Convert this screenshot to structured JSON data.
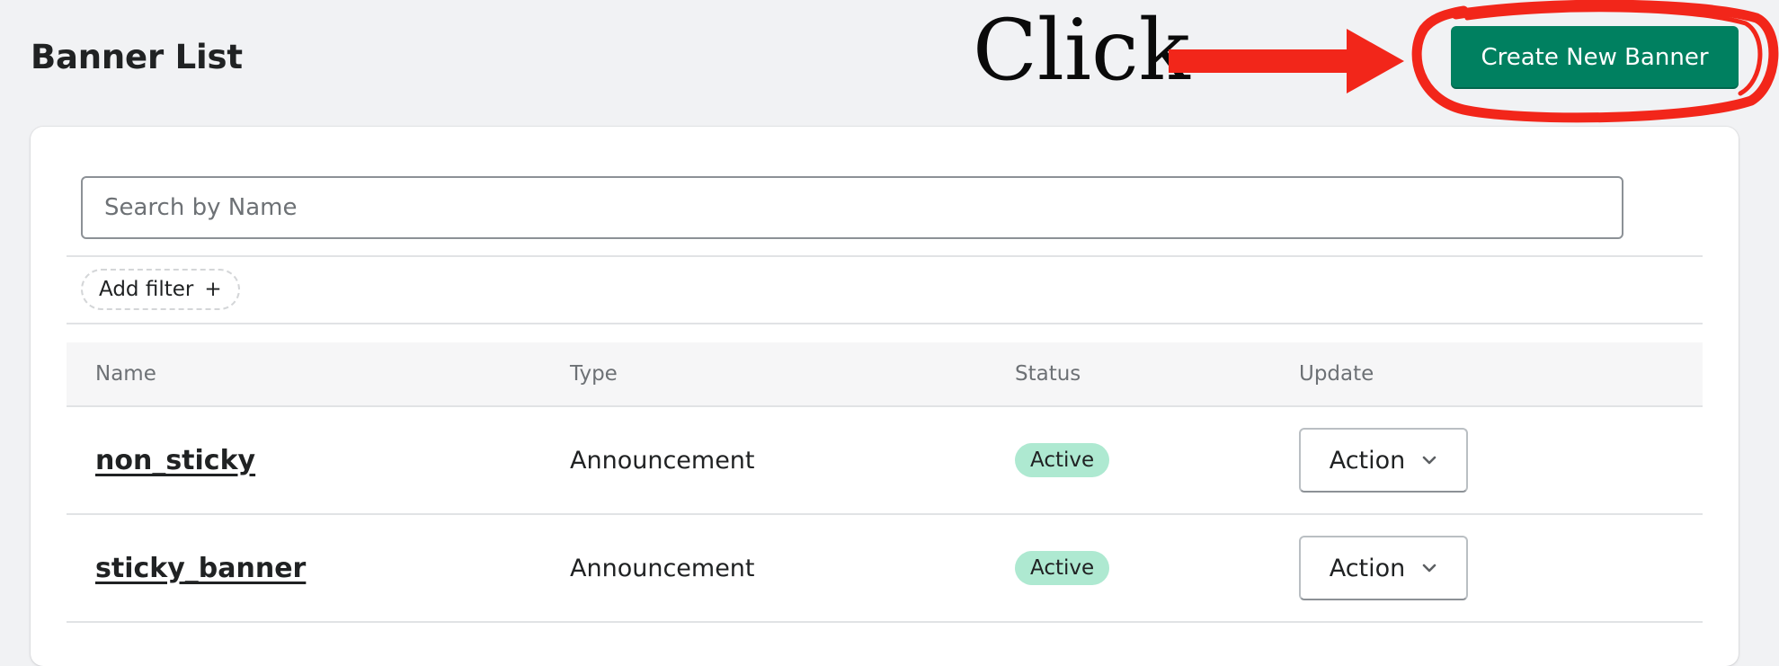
{
  "page": {
    "title": "Banner List"
  },
  "annotation": {
    "text": "Click",
    "color": "#f2261a"
  },
  "header": {
    "create_button_label": "Create New Banner"
  },
  "search": {
    "placeholder": "Search by Name"
  },
  "filters": {
    "add_filter_label": "Add filter",
    "add_filter_icon": "plus-icon"
  },
  "table": {
    "columns": [
      "Name",
      "Type",
      "Status",
      "Update"
    ],
    "rows": [
      {
        "name": "non_sticky",
        "type": "Announcement",
        "status": "Active",
        "action": "Action"
      },
      {
        "name": "sticky_banner",
        "type": "Announcement",
        "status": "Active",
        "action": "Action"
      }
    ]
  },
  "colors": {
    "primary": "#008060",
    "status_active_bg": "#aee9d1",
    "page_bg": "#f1f2f4"
  }
}
